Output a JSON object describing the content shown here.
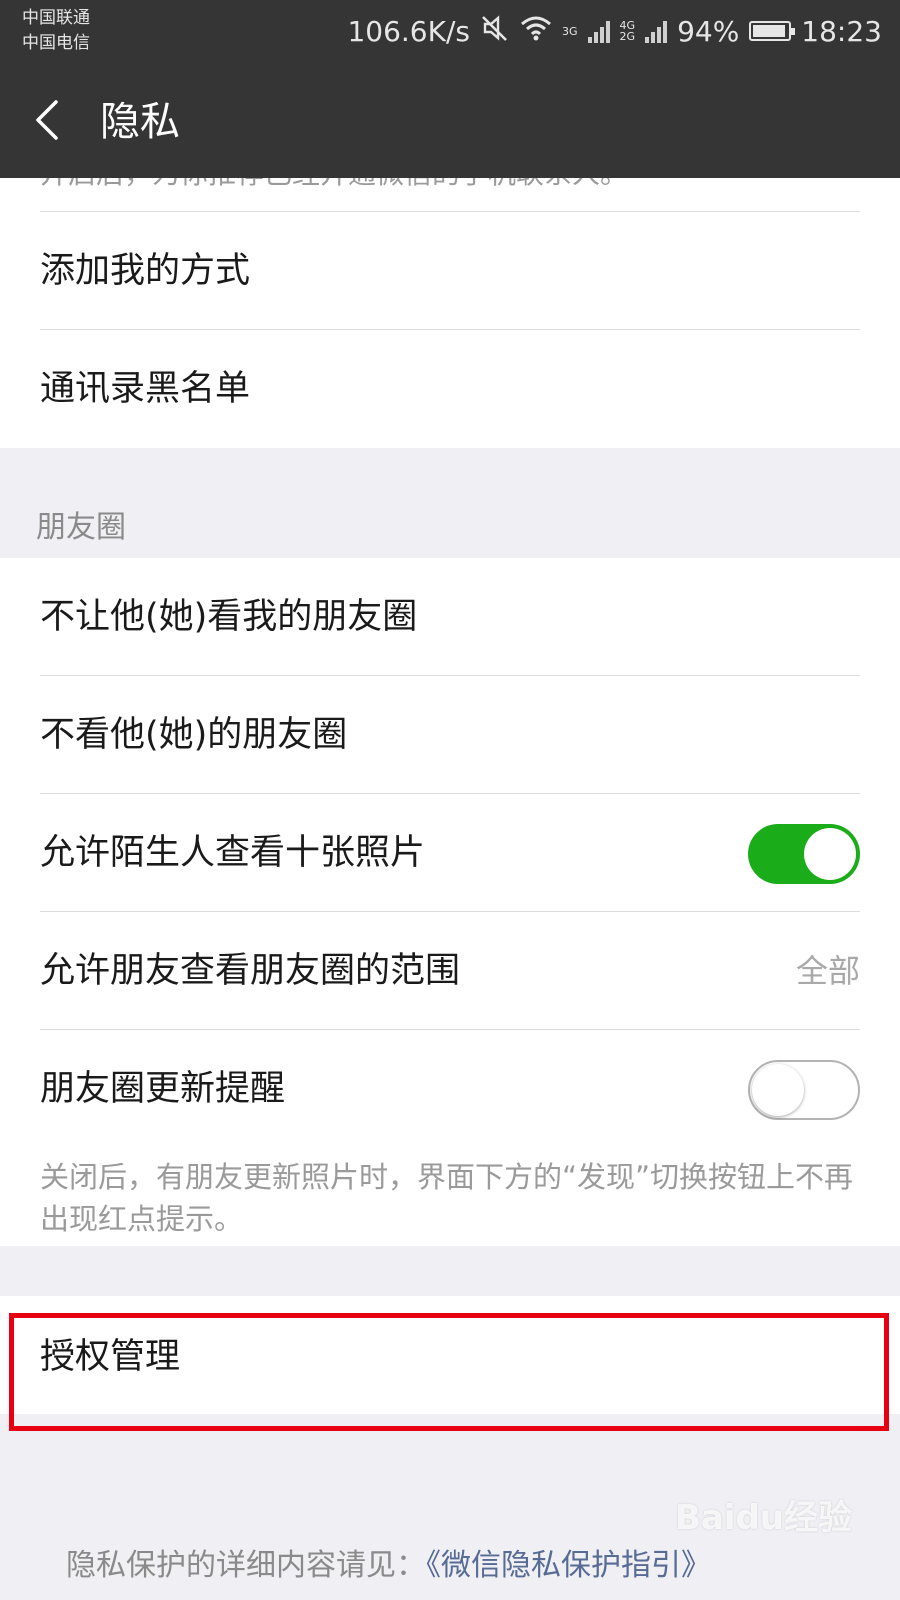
{
  "status_bar": {
    "carrier_1": "中国联通",
    "carrier_2": "中国电信",
    "net_speed": "106.6K/s",
    "net_1": "3G",
    "net_2a": "4G",
    "net_2b": "2G",
    "battery": "94%",
    "battery_level": 0.94,
    "time": "18:23",
    "icons": [
      "mute-icon",
      "wifi-icon",
      "signal-icon",
      "signal-icon",
      "battery-icon"
    ]
  },
  "nav": {
    "title": "隐私",
    "back_icon": "chevron-left-icon"
  },
  "top_cut_text": "开启后，为你推荐已经开通微信的手机联系人。",
  "contacts_group": {
    "items": [
      {
        "label": "添加我的方式"
      },
      {
        "label": "通讯录黑名单"
      }
    ]
  },
  "moments_section": {
    "header": "朋友圈",
    "items": [
      {
        "label": "不让他(她)看我的朋友圈"
      },
      {
        "label": "不看他(她)的朋友圈"
      },
      {
        "label": "允许陌生人查看十张照片",
        "toggle": true
      },
      {
        "label": "允许朋友查看朋友圈的范围",
        "value": "全部"
      },
      {
        "label": "朋友圈更新提醒",
        "toggle": false
      }
    ],
    "hint": "关闭后，有朋友更新照片时，界面下方的“发现”切换按钮上不再出现红点提示。"
  },
  "auth_group": {
    "label": "授权管理"
  },
  "footer": {
    "text": "隐私保护的详细内容请见：",
    "link": "《微信隐私保护指引》"
  },
  "watermark": "Baidu经验",
  "colors": {
    "toggle_on": "#1aad19",
    "highlight": "#e60012",
    "link": "#576b95"
  }
}
